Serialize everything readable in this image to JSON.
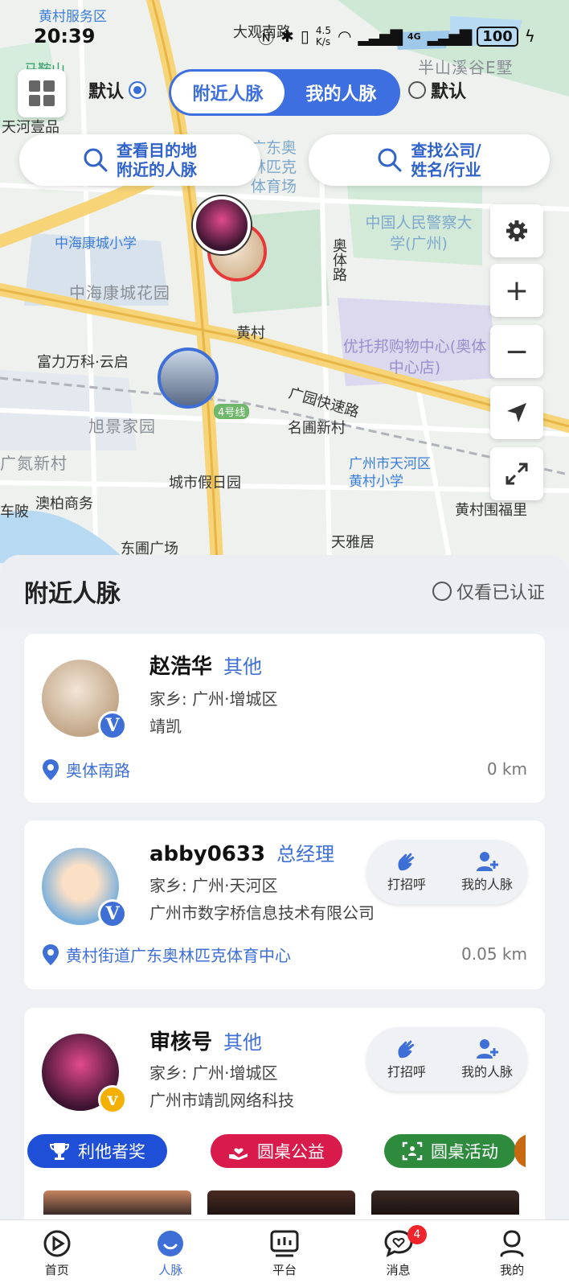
{
  "status_bar": {
    "time": "20:39",
    "net_speed": "4.5\nK/s",
    "battery": "100",
    "network": "4G"
  },
  "map": {
    "labels": {
      "service_area": "黄村服务区",
      "dagongnan_road": "大观南路",
      "banshan": "半山溪谷E墅",
      "tianhe_yipin": "天河壹品",
      "maanshan": "马鞍山",
      "guangdong_olympic": "广东奥林匹克体育场",
      "police_univ": "中国人民警察大学(广州)",
      "zhonghai_school": "中海康城小学",
      "zhonghai_garden": "中海康城花园",
      "aoti_road": "奥体路",
      "huangcun": "黄村",
      "youtuobang": "优托邦购物中心(奥体中心店)",
      "fuli_wanke": "富力万科·云启",
      "guangyuan_express": "广园快速路",
      "xujing": "旭景家园",
      "line4": "4号线",
      "mingyuan": "名圃新村",
      "tianhe_school": "广州市天河区黄村小学",
      "dan_xincun": "广氮新村",
      "city_holiday": "城市假日园",
      "aobai": "澳柏商务",
      "huangcunwei": "黄村围福里",
      "chebei": "车陂",
      "dongwei": "东圃广场",
      "tianya": "天雅居"
    },
    "mode_default_left": "默认",
    "mode_default_right": "默认",
    "segment": [
      "附近人脉",
      "我的人脉"
    ],
    "search_destination": "查看目的地\n附近的人脉",
    "search_company": "查找公司/\n姓名/行业"
  },
  "panel": {
    "title": "附近人脉",
    "verified_only": "仅看已认证"
  },
  "people": [
    {
      "name": "赵浩华",
      "role": "其他",
      "hometown": "家乡: 广州·增城区",
      "company": "靖凯",
      "location": "奥体南路",
      "distance": "0 km",
      "badge": "V"
    },
    {
      "name": "abby0633",
      "role": "总经理",
      "hometown": "家乡: 广州·天河区",
      "company": "广州市数字桥信息技术有限公司",
      "location": "黄村街道广东奥林匹克体育中心",
      "distance": "0.05 km",
      "badge": "V",
      "actions": [
        "打招呼",
        "我的人脉"
      ]
    },
    {
      "name": "审核号",
      "role": "其他",
      "hometown": "家乡: 广州·增城区",
      "company": "广州市靖凯网络科技",
      "badge": "v",
      "actions": [
        "打招呼",
        "我的人脉"
      ],
      "tags": [
        {
          "label": "利他者奖",
          "color": "#1f4fd6"
        },
        {
          "label": "圆桌公益",
          "color": "#d81b4a"
        },
        {
          "label": "圆桌活动",
          "color": "#2e8b3e"
        }
      ]
    }
  ],
  "tabbar": {
    "items": [
      "首页",
      "人脉",
      "平台",
      "消息",
      "我的"
    ],
    "message_badge": "4"
  }
}
